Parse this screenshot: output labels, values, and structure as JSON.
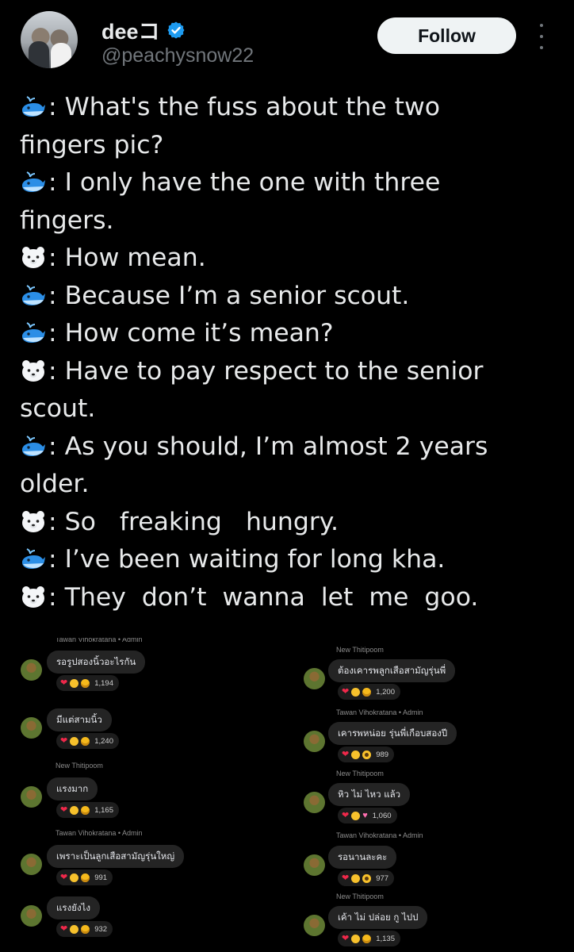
{
  "header": {
    "display_name": "deeコ",
    "handle": "@peachysnow22",
    "follow_label": "Follow",
    "verified_icon": "verified-badge-icon",
    "more_icon": "more-options-icon"
  },
  "tweet": {
    "lines": [
      {
        "speaker": "whale",
        "text": ": What's the fuss about the two"
      },
      {
        "speaker": "",
        "text": "fingers pic?"
      },
      {
        "speaker": "whale",
        "text": ": I only have the one with three"
      },
      {
        "speaker": "",
        "text": "fingers."
      },
      {
        "speaker": "polar-bear",
        "text": ": How mean."
      },
      {
        "speaker": "whale",
        "text": ": Because I’m a senior scout."
      },
      {
        "speaker": "whale",
        "text": ": How come it’s mean?"
      },
      {
        "speaker": "polar-bear",
        "text": ": Have to pay respect to the senior"
      },
      {
        "speaker": "",
        "text": "scout."
      },
      {
        "speaker": "whale",
        "text": ": As you should, I’m almost 2 years"
      },
      {
        "speaker": "",
        "text": "older."
      },
      {
        "speaker": "polar-bear",
        "text": ": So   freaking   hungry."
      },
      {
        "speaker": "whale",
        "text": ": I’ve been waiting for long kha."
      },
      {
        "speaker": "polar-bear",
        "text": ": They  don’t  wanna  let  me  goo."
      }
    ]
  },
  "comments": {
    "left": [
      {
        "name": "Tawan Vihokratana • Admin",
        "text": "รอรูปสองนิ้วอะไรกัน",
        "icons": [
          "heart",
          "laugh",
          "grin"
        ],
        "count": "1,194"
      },
      {
        "name": "",
        "text": "มีแต่สามนิ้ว",
        "icons": [
          "heart",
          "laugh",
          "grin"
        ],
        "count": "1,240"
      },
      {
        "name": "New Thitipoom",
        "text": "แรงมาก",
        "icons": [
          "heart",
          "laugh",
          "grin"
        ],
        "count": "1,165"
      },
      {
        "name": "Tawan Vihokratana • Admin",
        "text": "เพราะเป็นลูกเสือสามัญรุ่นใหญ่",
        "icons": [
          "heart",
          "laugh",
          "grin"
        ],
        "count": "991"
      },
      {
        "name": "",
        "text": "แรงยังไง",
        "icons": [
          "heart",
          "laugh",
          "grin"
        ],
        "count": "932"
      }
    ],
    "right": [
      {
        "name": "New Thitipoom",
        "text": "ต้องเคารพลูกเสือสามัญรุ่นพี่",
        "icons": [
          "heart",
          "laugh",
          "grin"
        ],
        "count": "1,200"
      },
      {
        "name": "Tawan Vihokratana • Admin",
        "text": "เคารพหน่อย รุ่นพี่เกือบสองปี",
        "icons": [
          "heart",
          "laugh",
          "wow"
        ],
        "count": "989"
      },
      {
        "name": "New Thitipoom",
        "text": "หิว ไม่ ไหว แล้ว",
        "icons": [
          "heart",
          "laugh",
          "pink-heart"
        ],
        "count": "1,060"
      },
      {
        "name": "Tawan Vihokratana • Admin",
        "text": "รอนานละคะ",
        "icons": [
          "heart",
          "laugh",
          "wow"
        ],
        "count": "977"
      },
      {
        "name": "New Thitipoom",
        "text": "เค้า ไม่ ปล่อย กู ไปป",
        "icons": [
          "heart",
          "laugh",
          "grin"
        ],
        "count": "1,135"
      }
    ]
  },
  "colors": {
    "background": "#000000",
    "text": "#e7e9ea",
    "handle": "#71767b",
    "verified": "#1d9bf0",
    "follow_bg": "#eff3f4"
  }
}
